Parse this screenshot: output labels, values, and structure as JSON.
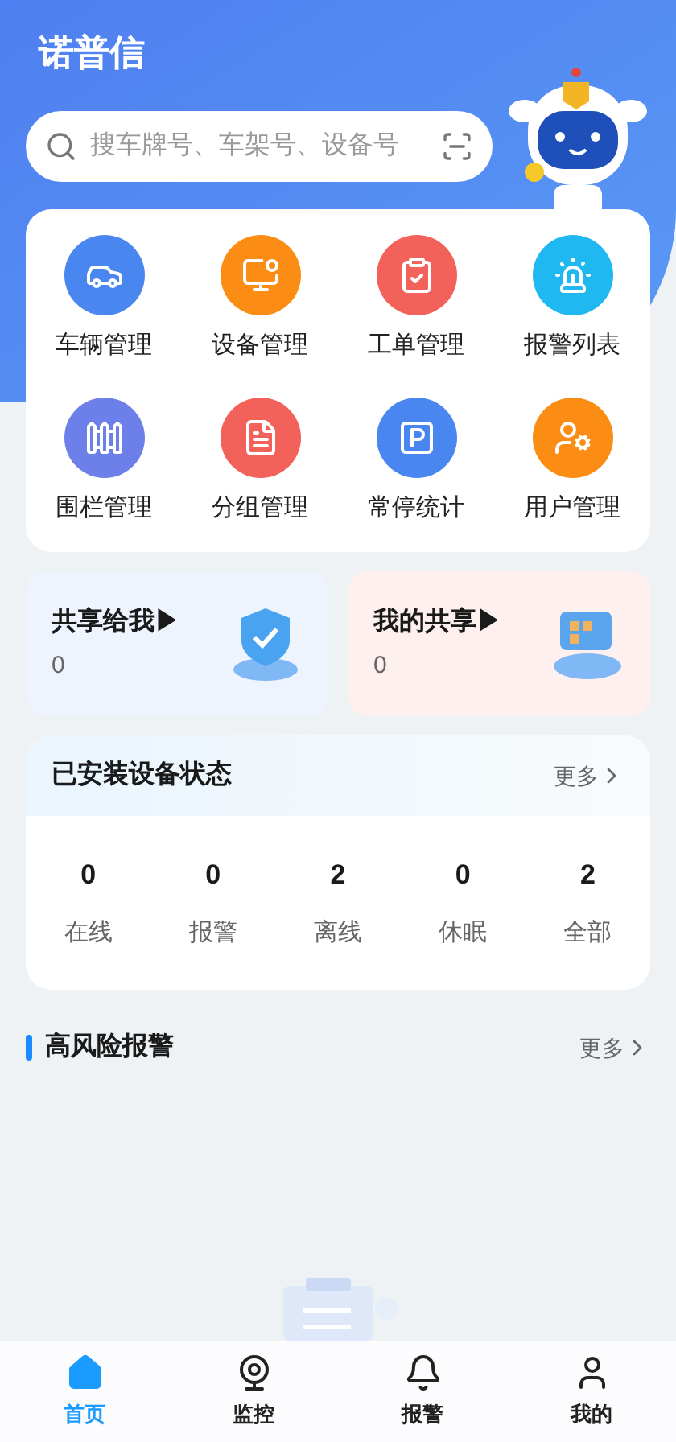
{
  "app_title": "诺普信",
  "search": {
    "placeholder": "搜车牌号、车架号、设备号"
  },
  "menu": [
    {
      "label": "车辆管理",
      "kind": "car",
      "color": "#4a86f0"
    },
    {
      "label": "设备管理",
      "kind": "device",
      "color": "#fb8c14"
    },
    {
      "label": "工单管理",
      "kind": "order",
      "color": "#f2625a"
    },
    {
      "label": "报警列表",
      "kind": "alarm",
      "color": "#1fb8f0"
    },
    {
      "label": "围栏管理",
      "kind": "fence",
      "color": "#6d7fe8"
    },
    {
      "label": "分组管理",
      "kind": "group",
      "color": "#f2625a"
    },
    {
      "label": "常停统计",
      "kind": "parking",
      "color": "#4a86f0"
    },
    {
      "label": "用户管理",
      "kind": "user",
      "color": "#fb8c14"
    }
  ],
  "shares": [
    {
      "title": "共享给我",
      "arrow": "▶",
      "count": "0",
      "kind": "shield"
    },
    {
      "title": "我的共享",
      "arrow": "▶",
      "count": "0",
      "kind": "board"
    }
  ],
  "device_status": {
    "title": "已安装设备状态",
    "more": "更多",
    "stats": [
      {
        "value": "0",
        "label": "在线"
      },
      {
        "value": "0",
        "label": "报警"
      },
      {
        "value": "2",
        "label": "离线"
      },
      {
        "value": "0",
        "label": "休眠"
      },
      {
        "value": "2",
        "label": "全部"
      }
    ]
  },
  "high_risk_alarms": {
    "title": "高风险报警",
    "more": "更多"
  },
  "tab_bar": [
    {
      "label": "首页",
      "kind": "home",
      "selected": true
    },
    {
      "label": "监控",
      "kind": "camera",
      "selected": false
    },
    {
      "label": "报警",
      "kind": "bell",
      "selected": false
    },
    {
      "label": "我的",
      "kind": "user",
      "selected": false
    }
  ]
}
